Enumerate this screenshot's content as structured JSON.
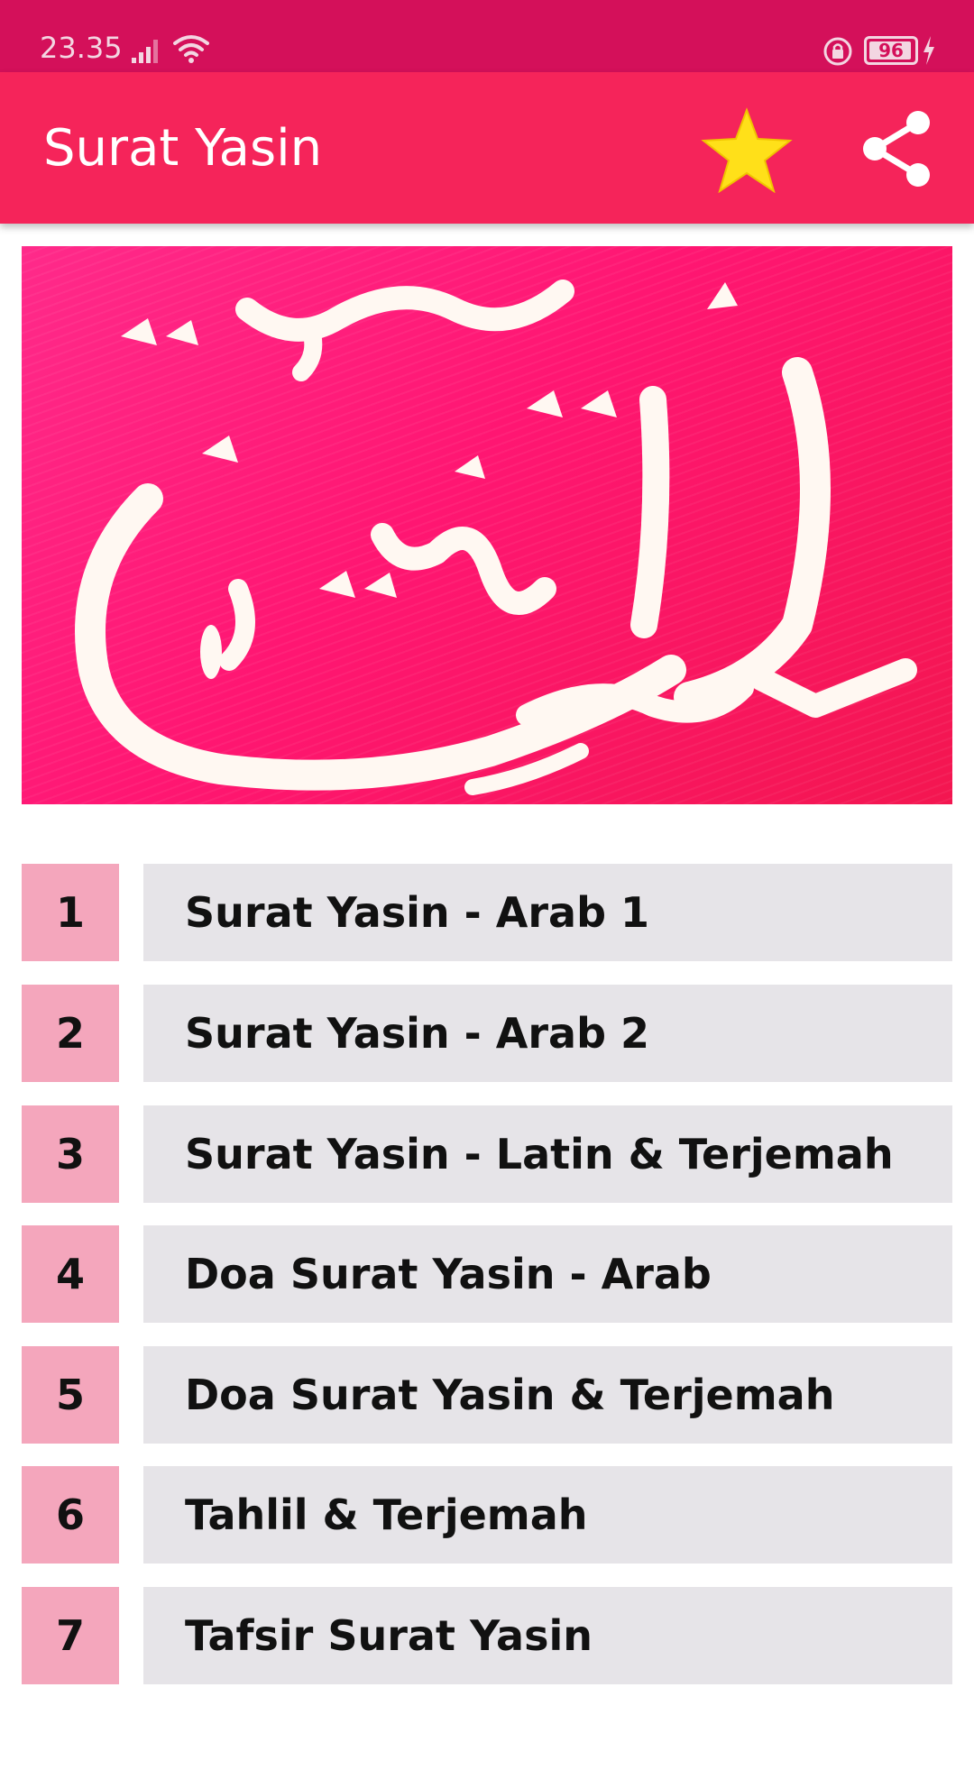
{
  "status_bar": {
    "time": "23.35",
    "battery": "96",
    "battery_level_percent": 96,
    "icons": [
      "signal-icon",
      "wifi-icon",
      "lock-icon",
      "battery-icon",
      "charging-icon"
    ]
  },
  "app_bar": {
    "title": "Surat Yasin",
    "actions": [
      "star-icon",
      "share-icon"
    ]
  },
  "banner": {
    "image": "yasin-calligraphy-banner"
  },
  "menu": {
    "items": [
      {
        "number": "1",
        "label": "Surat Yasin - Arab 1"
      },
      {
        "number": "2",
        "label": "Surat Yasin - Arab 2"
      },
      {
        "number": "3",
        "label": "Surat Yasin - Latin & Terjemah"
      },
      {
        "number": "4",
        "label": "Doa Surat Yasin - Arab"
      },
      {
        "number": "5",
        "label": "Doa Surat Yasin & Terjemah"
      },
      {
        "number": "6",
        "label": "Tahlil & Terjemah"
      },
      {
        "number": "7",
        "label": "Tafsir Surat Yasin"
      }
    ]
  },
  "colors": {
    "status_bar": "#d4105a",
    "app_bar": "#f5245a",
    "number_box": "#f4a6bc",
    "label_box": "#e6e4e8",
    "star": "#ffe019"
  }
}
